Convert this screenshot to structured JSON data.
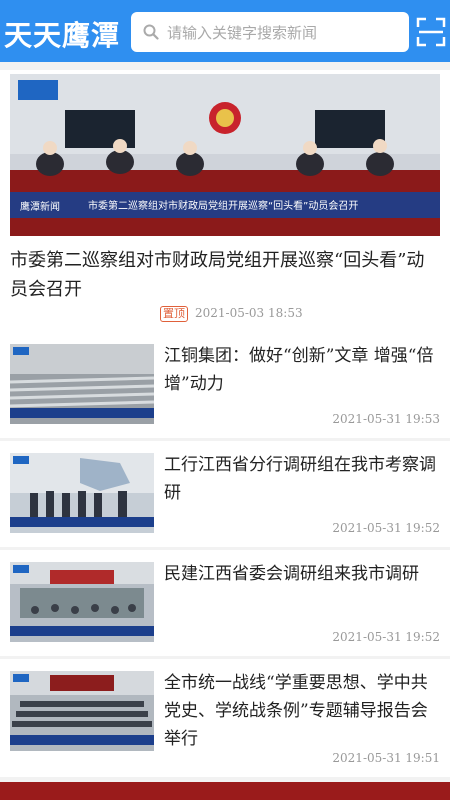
{
  "header": {
    "logo": "天天鹰潭",
    "search_placeholder": "请输入关键字搜索新闻"
  },
  "hero": {
    "title": "市委第二巡察组对市财政局党组开展巡察“回头看”动员会召开",
    "tag": "置顶",
    "time": "2021-05-03 18:53",
    "image_caption": "市委第二巡察组对市财政局党组开展巡察“回头看”动员会召开",
    "image_channel": "鹰潭新闻"
  },
  "items": [
    {
      "title": "江铜集团：做好“创新”文章 增强“倍增”动力",
      "time": "2021-05-31 19:53"
    },
    {
      "title": "工行江西省分行调研组在我市考察调研",
      "time": "2021-05-31 19:52"
    },
    {
      "title": "民建江西省委会调研组来我市调研",
      "time": "2021-05-31 19:52"
    },
    {
      "title": "全市统一战线“学重要思想、学中共党史、学统战条例”专题辅导报告会举行",
      "time": "2021-05-31 19:51"
    }
  ],
  "colors": {
    "brand": "#2f8ff0",
    "tag": "#e0603a"
  },
  "icons": {
    "search": "search-icon",
    "scan": "scan-icon"
  }
}
